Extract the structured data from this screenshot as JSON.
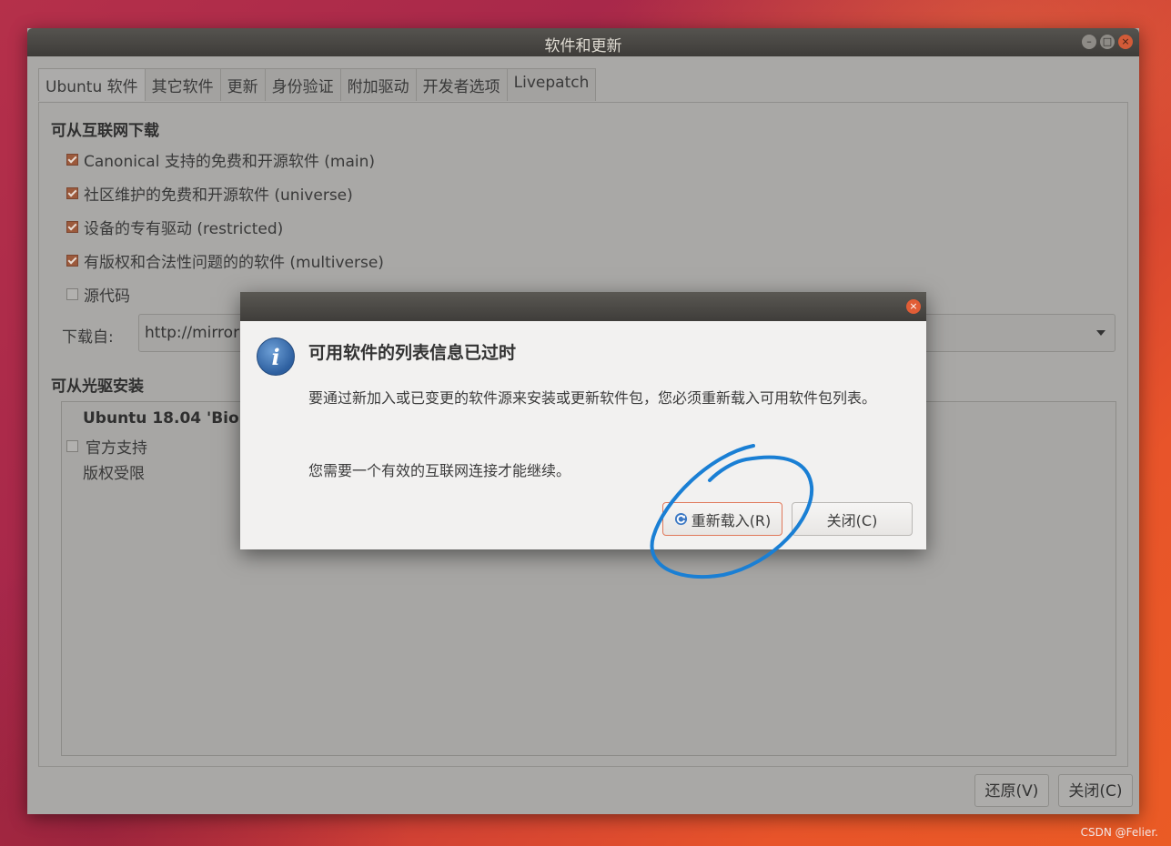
{
  "window": {
    "title": "软件和更新",
    "controls": [
      "minimize",
      "maximize",
      "close"
    ]
  },
  "tabs": [
    {
      "label": "Ubuntu 软件",
      "active": true
    },
    {
      "label": "其它软件",
      "active": false
    },
    {
      "label": "更新",
      "active": false
    },
    {
      "label": "身份验证",
      "active": false
    },
    {
      "label": "附加驱动",
      "active": false
    },
    {
      "label": "开发者选项",
      "active": false
    },
    {
      "label": "Livepatch",
      "active": false
    }
  ],
  "internet": {
    "heading": "可从互联网下载",
    "sources": [
      {
        "label": "Canonical 支持的免费和开源软件 (main)",
        "checked": true
      },
      {
        "label": "社区维护的免费和开源软件 (universe)",
        "checked": true
      },
      {
        "label": "设备的专有驱动 (restricted)",
        "checked": true
      },
      {
        "label": "有版权和合法性问题的的软件 (multiverse)",
        "checked": true
      },
      {
        "label": "源代码",
        "checked": false
      }
    ],
    "download_from_label": "下载自:",
    "download_from_value": "http://mirror"
  },
  "cdrom": {
    "heading": "可从光驱安装",
    "disc_title": "Ubuntu 18.04 'Bionic",
    "official_support_label": "官方支持",
    "restricted_label": "版权受限",
    "official_support_checked": false
  },
  "footer": {
    "revert_label": "还原(V)",
    "close_label": "关闭(C)"
  },
  "dialog": {
    "icon": "info-icon",
    "title": "可用软件的列表信息已过时",
    "body1": "要通过新加入或已变更的软件源来安装或更新软件包，您必须重新载入可用软件包列表。",
    "body2": "您需要一个有效的互联网连接才能继续。",
    "reload_label": "重新载入(R)",
    "close_label": "关闭(C)"
  },
  "watermark": "CSDN @Felier.",
  "colors": {
    "accent": "#e0785a",
    "annotation": "#1a7fd4",
    "info_icon": "#2d5f9f"
  }
}
